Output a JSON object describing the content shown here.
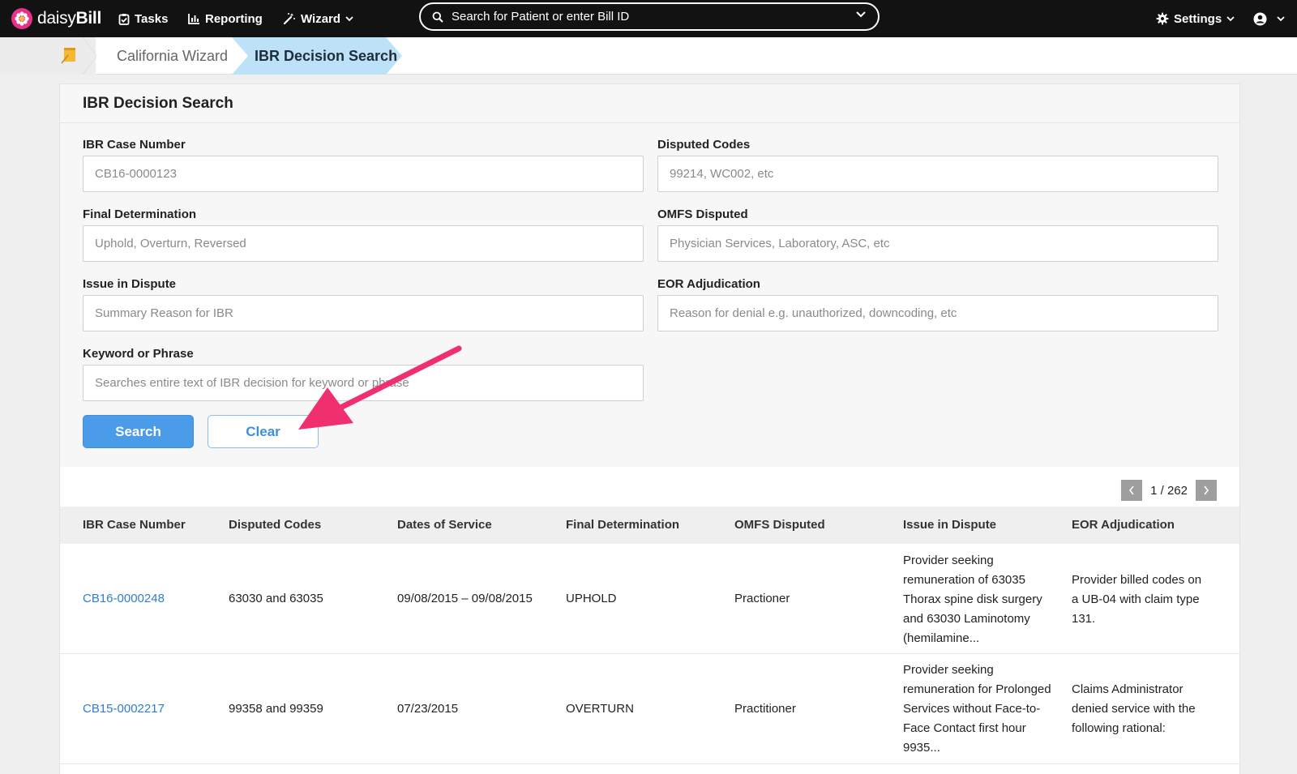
{
  "nav": {
    "brand_prefix": "daisy",
    "brand_suffix": "Bill",
    "tasks": "Tasks",
    "reporting": "Reporting",
    "wizard": "Wizard",
    "search_placeholder": "Search for Patient or enter Bill ID",
    "settings": "Settings"
  },
  "breadcrumb": {
    "wizard": "California Wizard",
    "current": "IBR Decision Search"
  },
  "panel": {
    "title": "IBR Decision Search"
  },
  "form": {
    "case_number": {
      "label": "IBR Case Number",
      "placeholder": "CB16-0000123"
    },
    "disputed_codes": {
      "label": "Disputed Codes",
      "placeholder": "99214, WC002, etc"
    },
    "final_determination": {
      "label": "Final Determination",
      "placeholder": "Uphold, Overturn, Reversed"
    },
    "omfs_disputed": {
      "label": "OMFS Disputed",
      "placeholder": "Physician Services, Laboratory, ASC, etc"
    },
    "issue": {
      "label": "Issue in Dispute",
      "placeholder": "Summary Reason for IBR"
    },
    "eor": {
      "label": "EOR Adjudication",
      "placeholder": "Reason for denial e.g. unauthorized, downcoding, etc"
    },
    "keyword": {
      "label": "Keyword or Phrase",
      "placeholder": "Searches entire text of IBR decision for keyword or phrase"
    },
    "search_button": "Search",
    "clear_button": "Clear"
  },
  "pager": {
    "text": "1 / 262"
  },
  "table": {
    "headers": [
      "IBR Case Number",
      "Disputed Codes",
      "Dates of Service",
      "Final Determination",
      "OMFS Disputed",
      "Issue in Dispute",
      "EOR Adjudication"
    ],
    "rows": [
      {
        "case": "CB16-0000248",
        "codes": "63030 and 63035",
        "dates": "09/08/2015 – 09/08/2015",
        "determination": "UPHOLD",
        "omfs": "Practioner",
        "issue": [
          "Provider seeking",
          "remuneration of 63035",
          "Thorax spine disk surgery",
          "and 63030 Laminotomy",
          "(hemilamine..."
        ],
        "eor": [
          "Provider billed codes on",
          "a UB-04 with claim type",
          "131."
        ]
      },
      {
        "case": "CB15-0002217",
        "codes": "99358 and 99359",
        "dates": "07/23/2015",
        "determination": "OVERTURN",
        "omfs": "Practitioner",
        "issue": [
          "Provider seeking",
          "remuneration for Prolonged",
          "Services without Face-to-",
          "Face Contact first hour",
          "9935..."
        ],
        "eor": [
          "Claims Administrator",
          "denied service with the",
          "following rational:"
        ]
      }
    ]
  },
  "colors": {
    "topbar": "#121212",
    "accent": "#4a9be8",
    "link": "#2f7dd1",
    "annotation_arrow": "#f0306e"
  }
}
